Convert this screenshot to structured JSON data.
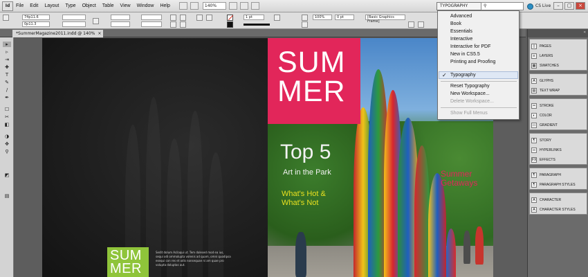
{
  "menubar": {
    "logo": "Id",
    "items": [
      "File",
      "Edit",
      "Layout",
      "Type",
      "Object",
      "Table",
      "View",
      "Window",
      "Help"
    ],
    "zoom": "140%",
    "workspace_button": "TYPOGRAPHY",
    "cs_live": "CS Live"
  },
  "controlbar": {
    "x_field": "74p11.6",
    "y_field": "0p11.3",
    "stroke_weight": "1 pt",
    "percent": "100%",
    "frame_style": "[Basic Graphics Frame]",
    "pt": "0 pt"
  },
  "document": {
    "tab_title": "*SummerMagazine2011.indd @ 140%"
  },
  "toolbar": {
    "tools": [
      "▸",
      "▹",
      "⇥",
      "✚",
      "T",
      "✎",
      "/",
      "✒",
      "☐",
      "✂",
      "◧",
      "◑",
      "✥",
      "⚲",
      "◩",
      "▤"
    ]
  },
  "spread": {
    "left_page": {
      "mini_title": "SUM\nMER",
      "body_copy": "Sedit dolum Acilaqui ut. Tem dolesed mod ea ius, sequi odi ommolupta volenis ad quam, omni quodipsa esequi con res et odis nonsequae ni am quae pro volupta doluptas aut."
    },
    "right_page": {
      "summer_title": "SUM\nMER",
      "top5": "Top 5",
      "art_park": "Art in the Park",
      "whats_hot": "What's Hot &\nWhat's Not",
      "getaways": "Summer\nGetaways"
    }
  },
  "workspace_menu": {
    "items": [
      {
        "label": "Advanced"
      },
      {
        "label": "Book"
      },
      {
        "label": "Essentials"
      },
      {
        "label": "Interactive"
      },
      {
        "label": "Interactive for PDF"
      },
      {
        "label": "New in CS5.5"
      },
      {
        "label": "Printing and Proofing"
      },
      {
        "label": "Typography",
        "checked": true
      }
    ],
    "actions": [
      {
        "label": "Reset Typography"
      },
      {
        "label": "New Workspace..."
      },
      {
        "label": "Delete Workspace...",
        "disabled": true
      }
    ],
    "footer": {
      "label": "Show Full Menus",
      "disabled": true
    }
  },
  "panels": {
    "groups": [
      [
        "Pages",
        "Layers",
        "Swatches"
      ],
      [
        "Glyphs",
        "Text Wrap"
      ],
      [
        "Stroke",
        "Color",
        "Gradient"
      ],
      [
        "Story",
        "Hyperlinks",
        "Effects"
      ],
      [
        "Paragraph",
        "Paragraph Styles"
      ],
      [
        "Character",
        "Character Styles"
      ]
    ]
  },
  "colors": {
    "summer_pink": "#e2265a",
    "summer_green": "#8fc43a",
    "whats_yellow": "#e8e020"
  }
}
